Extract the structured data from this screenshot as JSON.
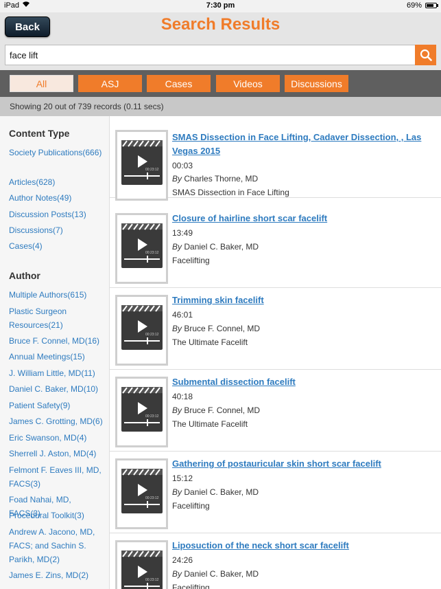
{
  "status_bar": {
    "carrier": "iPad",
    "time": "7:30 pm",
    "battery": "69%"
  },
  "nav": {
    "back_label": "Back",
    "title": "Search Results"
  },
  "search": {
    "value": "face lift"
  },
  "colors": {
    "accent": "#f07c2a",
    "link": "#2e7bbf"
  },
  "filters": [
    {
      "label": "All",
      "active": true
    },
    {
      "label": "ASJ",
      "active": false
    },
    {
      "label": "Cases",
      "active": false
    },
    {
      "label": "Videos",
      "active": false
    },
    {
      "label": "Discussions",
      "active": false
    }
  ],
  "summary": "Showing 20 out of 739 records (0.11 secs)",
  "sidebar": {
    "content_type_heading": "Content Type",
    "content_types": [
      "Society Publications(666)",
      "Articles(628)",
      "Author Notes(49)",
      "Discussion Posts(13)",
      "Discussions(7)",
      "Cases(4)"
    ],
    "author_heading": "Author",
    "authors": [
      "Multiple Authors(615)",
      "Plastic Surgeon Resources(21)",
      "Bruce F. Connel, MD(16)",
      "Annual Meetings(15)",
      "J. William Little, MD(11)",
      "Daniel C. Baker, MD(10)",
      "Patient Safety(9)",
      "James C. Grotting, MD(6)",
      "Eric Swanson, MD(4)",
      "Sherrell J. Aston, MD(4)",
      "Felmont F. Eaves III, MD, FACS(3)",
      "Foad Nahai, MD, FACS(3)",
      "Procedural Toolkit(3)",
      "Andrew A. Jacono, MD, FACS; and Sachin S. Parikh, MD(2)",
      "James E. Zins, MD(2)"
    ]
  },
  "by_label": "By",
  "thumb_timestamp": "00:23:12",
  "results": [
    {
      "title": "SMAS Dissection in Face Lifting, Cadaver Dissection, , Las Vegas 2015",
      "duration": "00:03",
      "author": "Charles Thorne, MD",
      "description": "SMAS Dissection in Face Lifting"
    },
    {
      "title": "Closure of hairline short scar facelift",
      "duration": "13:49",
      "author": "Daniel C. Baker, MD",
      "description": "Facelifting"
    },
    {
      "title": "Trimming skin facelift",
      "duration": "46:01",
      "author": "Bruce F. Connel, MD",
      "description": "The Ultimate Facelift"
    },
    {
      "title": "Submental dissection facelift",
      "duration": "40:18",
      "author": "Bruce F. Connel, MD",
      "description": "The Ultimate Facelift"
    },
    {
      "title": "Gathering of postauricular skin short scar facelift",
      "duration": "15:12",
      "author": "Daniel C. Baker, MD",
      "description": "Facelifting"
    },
    {
      "title": "Liposuction of the neck short scar facelift",
      "duration": "24:26",
      "author": "Daniel C. Baker, MD",
      "description": "Facelifting"
    }
  ]
}
